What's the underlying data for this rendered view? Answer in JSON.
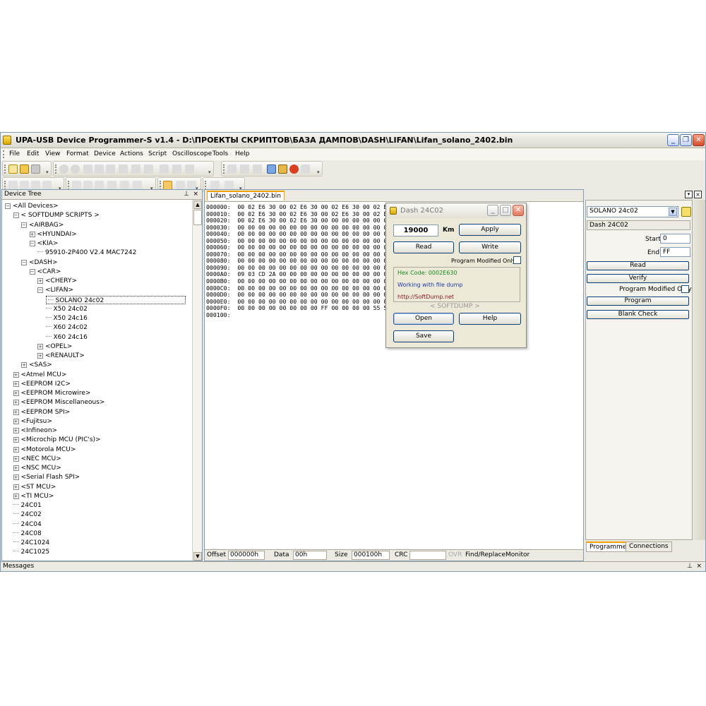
{
  "window": {
    "title": "UPA-USB Device Programmer-S v1.4 - D:\\ПРОЕКТЫ СКРИПТОВ\\БАЗА ДАМПОВ\\DASH\\LIFAN\\Lifan_solano_2402.bin"
  },
  "menu": [
    "File",
    "Edit",
    "View",
    "Format",
    "Device",
    "Actions",
    "Script",
    "Oscilloscope",
    "Tools",
    "Help"
  ],
  "device_tree": {
    "title": "Device Tree",
    "nodes": [
      "<All Devices>",
      "< SOFTDUMP SCRIPTS >",
      "<AIRBAG>",
      "<HYUNDAI>",
      "<KIA>",
      "95910-2P400 V2.4 MAC7242",
      "<DASH>",
      "<CAR>",
      "<CHERY>",
      "<LIFAN>",
      "SOLANO 24c02",
      "X50 24c02",
      "X50 24c16",
      "X60 24c02",
      "X60 24c16",
      "<OPEL>",
      "<RENAULT>",
      "<SAS>",
      "<Atmel MCU>",
      "<EEPROM I2C>",
      "<EEPROM Microwire>",
      "<EEPROM Miscellaneous>",
      "<EEPROM SPI>",
      "<Fujitsu>",
      "<Infineon>",
      "<Microchip MCU (PIC's)>",
      "<Motorola MCU>",
      "<NEC MCU>",
      "<NSC MCU>",
      "<Serial Flash SPI>",
      "<ST MCU>",
      "<TI MCU>",
      "24C01",
      "24C02",
      "24C04",
      "24C08",
      "24C1024",
      "24C1025"
    ]
  },
  "editor": {
    "tab": "Lifan_solano_2402.bin",
    "hex_lines": [
      "000000:  00 02 E6 30 00 02 E6 30 00 02 E6 30 00 02 E6 3",
      "000010:  00 02 E6 30 00 02 E6 30 00 02 E6 30 00 02 E6 3",
      "000020:  00 02 E6 30 00 02 E6 30 00 00 00 00 00 00 00 0",
      "000030:  00 00 00 00 00 00 00 00 00 00 00 00 00 00 00 0",
      "000040:  00 00 00 00 00 00 00 00 00 00 00 00 00 00 00 0",
      "000050:  00 00 00 00 00 00 00 00 00 00 00 00 00 00 00 0",
      "000060:  00 00 00 00 00 00 00 00 00 00 00 00 00 00 00 0",
      "000070:  00 00 00 00 00 00 00 00 00 00 00 00 00 00 00 0",
      "000080:  00 00 00 00 00 00 00 00 00 00 00 00 00 00 00 0",
      "000090:  00 00 00 00 00 00 00 00 00 00 00 00 00 00 00 0",
      "0000A0:  09 03 CD 2A 00 00 00 00 00 00 00 00 00 00 00 0",
      "0000B0:  00 00 00 00 00 00 00 00 00 00 00 00 00 00 00 0",
      "0000C0:  00 00 00 00 00 00 00 00 00 00 00 00 00 00 00 0",
      "0000D0:  00 00 00 00 00 00 00 00 00 00 00 00 00 00 00 0",
      "0000E0:  00 00 00 00 00 00 00 00 00 00 00 00 00 00 00 0",
      "0000F0:  00 00 00 00 00 00 00 00 FF 00 00 00 00 55 55 F",
      "000100:"
    ],
    "status": {
      "offset_label": "Offset",
      "offset_value": "000000h",
      "data_label": "Data",
      "data_value": "00h",
      "size_label": "Size",
      "size_value": "000100h",
      "crc_label": "CRC",
      "crc_value": "",
      "ovr": "OVR",
      "find_replace": "Find/Replace",
      "monitor": "Monitor"
    }
  },
  "dialog": {
    "title": "Dash 24C02",
    "km_value": "19000",
    "km_unit": "Km",
    "apply": "Apply",
    "read": "Read",
    "write": "Write",
    "program_modified_only": "Program Modified Only",
    "hex_code": "Hex Code: 0002E630",
    "working": "Working with file dump",
    "url": "http://SoftDump.net",
    "brand": "< SOFTDUMP >",
    "open": "Open",
    "help": "Help",
    "save": "Save"
  },
  "programmer": {
    "device_select": "SOLANO 24c02",
    "device_name": "Dash 24C02",
    "start_label": "Start",
    "start_value": "0",
    "end_label": "End",
    "end_value": "FF",
    "read": "Read",
    "verify": "Verify",
    "program_modified_only": "Program Modified Only",
    "program": "Program",
    "blank_check": "Blank Check",
    "tabs": [
      "Programmer",
      "Connections"
    ]
  },
  "messages": {
    "title": "Messages"
  },
  "colors": {
    "accent_tab": "#f0a000",
    "hex_code_color": "#1a8a1a",
    "working_color": "#1f3aa8",
    "url_color": "#8a1a1a"
  }
}
